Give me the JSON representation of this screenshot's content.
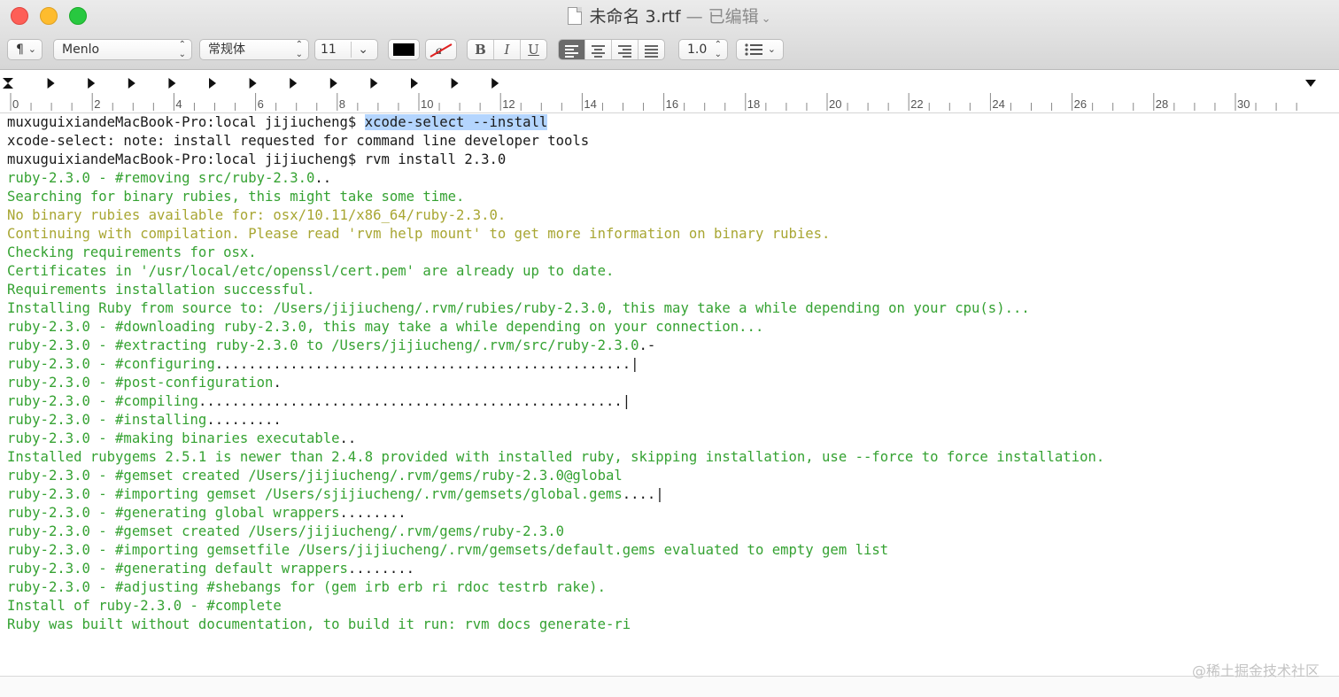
{
  "window": {
    "title": "未命名 3.rtf",
    "edited_label": "— 已编辑"
  },
  "toolbar": {
    "paragraph_style": "¶",
    "font_family": "Menlo",
    "font_style": "常规体",
    "font_size": "11",
    "text_color": "#000000",
    "bold": "B",
    "italic": "I",
    "underline": "U",
    "line_spacing": "1.0"
  },
  "ruler": {
    "labels": [
      "0",
      "2",
      "4",
      "6",
      "8",
      "10",
      "12",
      "14",
      "16",
      "18",
      "20",
      "22",
      "24",
      "26",
      "28",
      "30"
    ]
  },
  "terminal": {
    "lines": [
      {
        "color": "black",
        "pre": "muxuguixiandeMacBook-Pro:local jijiucheng$ ",
        "sel": "xcode-select --install"
      },
      {
        "color": "black",
        "pre": "xcode-select: note: install requested for command line developer tools"
      },
      {
        "color": "black",
        "pre": "muxuguixiandeMacBook-Pro:local jijiucheng$ rvm install 2.3.0"
      },
      {
        "color": "green",
        "pre": "ruby-2.3.0 - #removing src/ruby-2.3.0",
        "tail": ".."
      },
      {
        "color": "green",
        "pre": "Searching for binary rubies, this might take some time."
      },
      {
        "color": "olive",
        "pre": "No binary rubies available for: osx/10.11/x86_64/ruby-2.3.0."
      },
      {
        "color": "olive",
        "pre": "Continuing with compilation. Please read 'rvm help mount' to get more information on binary rubies."
      },
      {
        "color": "green",
        "pre": "Checking requirements for osx."
      },
      {
        "color": "green",
        "pre": "Certificates in '/usr/local/etc/openssl/cert.pem' are already up to date."
      },
      {
        "color": "green",
        "pre": "Requirements installation successful."
      },
      {
        "color": "green",
        "pre": "Installing Ruby from source to: /Users/jijiucheng/.rvm/rubies/ruby-2.3.0, this may take a while depending on your cpu(s)..."
      },
      {
        "color": "green",
        "pre": "ruby-2.3.0 - #downloading ruby-2.3.0, this may take a while depending on your connection..."
      },
      {
        "color": "green",
        "pre": "ruby-2.3.0 - #extracting ruby-2.3.0 to /Users/jijiucheng/.rvm/src/ruby-2.3.0",
        "tail": ".-"
      },
      {
        "color": "green",
        "pre": "ruby-2.3.0 - #configuring",
        "tail": "..................................................|"
      },
      {
        "color": "green",
        "pre": "ruby-2.3.0 - #post-configuration",
        "tail": "."
      },
      {
        "color": "green",
        "pre": "ruby-2.3.0 - #compiling",
        "tail": "...................................................|"
      },
      {
        "color": "green",
        "pre": "ruby-2.3.0 - #installing",
        "tail": "........."
      },
      {
        "color": "green",
        "pre": "ruby-2.3.0 - #making binaries executable",
        "tail": ".."
      },
      {
        "color": "green",
        "pre": "Installed rubygems 2.5.1 is newer than 2.4.8 provided with installed ruby, skipping installation, use --force to force installation."
      },
      {
        "color": "green",
        "pre": "ruby-2.3.0 - #gemset created /Users/jijiucheng/.rvm/gems/ruby-2.3.0@global"
      },
      {
        "color": "green",
        "pre": "ruby-2.3.0 - #importing gemset /Users/sjijiucheng/.rvm/gemsets/global.gems",
        "tail": "....|"
      },
      {
        "color": "green",
        "pre": "ruby-2.3.0 - #generating global wrappers",
        "tail": "........"
      },
      {
        "color": "green",
        "pre": "ruby-2.3.0 - #gemset created /Users/jijiucheng/.rvm/gems/ruby-2.3.0"
      },
      {
        "color": "green",
        "pre": "ruby-2.3.0 - #importing gemsetfile /Users/jijiucheng/.rvm/gemsets/default.gems evaluated to empty gem list"
      },
      {
        "color": "green",
        "pre": "ruby-2.3.0 - #generating default wrappers",
        "tail": "........"
      },
      {
        "color": "green",
        "pre": "ruby-2.3.0 - #adjusting #shebangs for (gem irb erb ri rdoc testrb rake)."
      },
      {
        "color": "green",
        "pre": "Install of ruby-2.3.0 - #complete"
      },
      {
        "color": "green",
        "pre": "Ruby was built without documentation, to build it run: rvm docs generate-ri"
      }
    ]
  },
  "watermark": "@稀土掘金技术社区"
}
